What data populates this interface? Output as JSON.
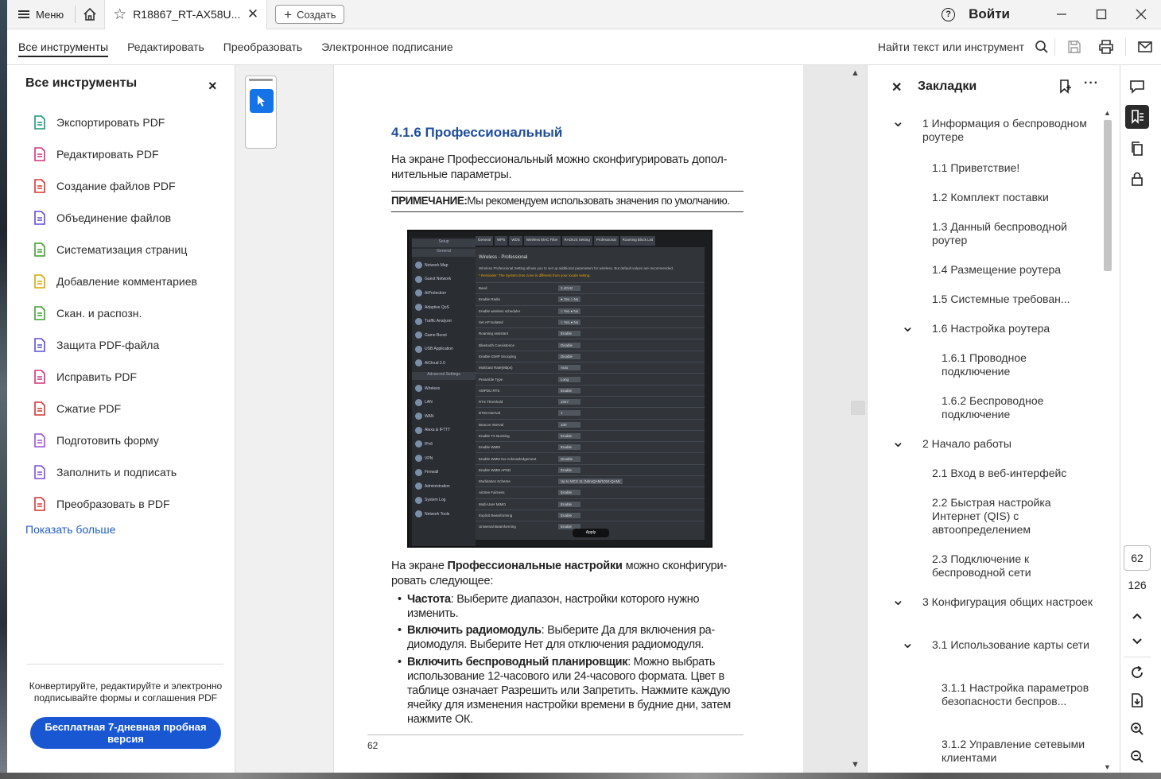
{
  "titlebar": {
    "menu_label": "Меню",
    "tab_name": "R18867_RT-AX58U...",
    "create_label": "Создать",
    "signin_label": "Войти"
  },
  "toolbar": {
    "tabs": [
      "Все инструменты",
      "Редактировать",
      "Преобразовать",
      "Электронное подписание"
    ],
    "find_label": "Найти текст или инструмент"
  },
  "tools": {
    "title": "Все инструменты",
    "items": [
      {
        "label": "Экспортировать PDF",
        "icon": "export-pdf-icon",
        "color": "#1a9a6c"
      },
      {
        "label": "Редактировать PDF",
        "icon": "edit-pdf-icon",
        "color": "#d2327b"
      },
      {
        "label": "Создание файлов PDF",
        "icon": "create-pdf-icon",
        "color": "#d83232"
      },
      {
        "label": "Объединение файлов",
        "icon": "combine-files-icon",
        "color": "#5b4fd6"
      },
      {
        "label": "Систематизация страниц",
        "icon": "organize-pages-icon",
        "color": "#3e9e2e"
      },
      {
        "label": "Добавление комментариев",
        "icon": "comment-icon",
        "color": "#d8a800"
      },
      {
        "label": "Скан. и распозн.",
        "icon": "scan-ocr-icon",
        "color": "#3e9e2e"
      },
      {
        "label": "Защита PDF-файла",
        "icon": "protect-pdf-icon",
        "color": "#5b4fd6"
      },
      {
        "label": "Исправить PDF",
        "icon": "redact-pdf-icon",
        "color": "#d2327b"
      },
      {
        "label": "Сжатие PDF",
        "icon": "compress-pdf-icon",
        "color": "#d83232"
      },
      {
        "label": "Подготовить форму",
        "icon": "prepare-form-icon",
        "color": "#9b4fd6"
      },
      {
        "label": "Заполнить и подписать",
        "icon": "fill-sign-icon",
        "color": "#7a4fd6"
      },
      {
        "label": "Преобразовать в PDF",
        "icon": "convert-pdf-icon",
        "color": "#d83232"
      }
    ],
    "show_more": "Показать больше",
    "promo_text": "Конвертируйте, редактируйте и электронно подписывайте формы и соглашения PDF",
    "trial_button": "Бесплатная 7-дневная пробная версия"
  },
  "document": {
    "section_heading": "4.1.6 Профессиональный",
    "intro": "На экране Профессиональный можно сконфигурировать допол-нительные параметры.",
    "note_label": "ПРИМЕЧАНИЕ:",
    "note_text": "Мы рекомендуем использовать значения по умолчанию.",
    "screenshot": {
      "sidebar": [
        "Setup",
        "General",
        "Network Map",
        "Guest Network",
        "AiProtection",
        "Adaptive QoS",
        "Traffic Analyzer",
        "Game Boost",
        "USB Application",
        "AiCloud 2.0",
        "Advanced Settings",
        "Wireless",
        "LAN",
        "WAN",
        "Alexa & IFTTT",
        "IPv6",
        "VPN",
        "Firewall",
        "Administration",
        "System Log",
        "Network Tools"
      ],
      "tabs": [
        "General",
        "WPS",
        "WDS",
        "Wireless MAC Filter",
        "RADIUS Setting",
        "Professional",
        "Roaming Block List"
      ],
      "title": "Wireless - Professional",
      "description": "Wireless Professional Setting allows you to set up additional parameters for wireless. But default values are recommended.",
      "warning": "* Reminder: The System time zone is different from your locale setting.",
      "rows": [
        [
          "Band",
          "2.4GHz"
        ],
        [
          "Enable Radio",
          "● Yes ○ No"
        ],
        [
          "Enable wireless scheduler",
          "○ Yes ● No"
        ],
        [
          "Set AP Isolated",
          "○ Yes ● No"
        ],
        [
          "Roaming assistant",
          "Enable"
        ],
        [
          "Bluetooth Coexistence",
          "Disable"
        ],
        [
          "Enable IGMP Snooping",
          "Disable"
        ],
        [
          "Multicast Rate(Mbps)",
          "Auto"
        ],
        [
          "Preamble Type",
          "Long"
        ],
        [
          "AMPDU RTS",
          "Enable"
        ],
        [
          "RTS Threshold",
          "2347"
        ],
        [
          "DTIM Interval",
          "1"
        ],
        [
          "Beacon Interval",
          "100"
        ],
        [
          "Enable TX Bursting",
          "Enable"
        ],
        [
          "Enable WMM",
          "Enable"
        ],
        [
          "Enable WMM No-Acknowledgement",
          "Disable"
        ],
        [
          "Enable WMM APSD",
          "Enable"
        ],
        [
          "Modulation Scheme",
          "Up to MCS 11 (NitroQAM/1024-QAM)"
        ],
        [
          "Airtime Fairness",
          "Enable"
        ],
        [
          "Multi-User MIMO",
          "Enable"
        ],
        [
          "Explicit Beamforming",
          "Enable"
        ],
        [
          "Universal Beamforming",
          "Enable"
        ]
      ],
      "apply": "Apply"
    },
    "para2_pre": "На экране ",
    "para2_bold": "Профессиональные настройки",
    "para2_post": " можно сконфигури-ровать следующее:",
    "bullets": [
      {
        "bold": "Частота",
        "text": ":  Выберите диапазон, настройки которого нужно изменить."
      },
      {
        "bold": "Включить радиомодуль",
        "text": ":  Выберите Да для включения ра-диомодуля. Выберите Нет для отключения радиомодуля."
      },
      {
        "bold": "Включить беспроводный планировщик",
        "text": ": Можно выбрать использование 12-часового или 24-часового формата. Цвет в таблице означает Разрешить или Запретить. Нажмите каждую ячейку для изменения настройки времени в будние дни, затем нажмите ОК."
      }
    ],
    "page_number": "62"
  },
  "bookmarks": {
    "title": "Закладки",
    "items": [
      {
        "label": "1 Информация о беспроводном роутере",
        "level": 0,
        "expanded": true
      },
      {
        "label": "1.1 Приветствие!",
        "level": 1
      },
      {
        "label": "1.2 Комплект поставки",
        "level": 1
      },
      {
        "label": "1.3 Данный беспроводной роутер",
        "level": 1
      },
      {
        "label": "1.4 Размещение роутера",
        "level": 1
      },
      {
        "label": "1.5 Системные требован...",
        "level": 1
      },
      {
        "label": "1.6 Настройка роутера",
        "level": 1,
        "expanded": true
      },
      {
        "label": "1.6.1 Проводное подключение",
        "level": 2
      },
      {
        "label": "1.6.2 Беспроводное подключение",
        "level": 2
      },
      {
        "label": "2 Начало работы",
        "level": 0,
        "expanded": true
      },
      {
        "label": "2.1 Вход в веб-интерфейс",
        "level": 1
      },
      {
        "label": "2.2 Быстрая настройка Интернет (QIS) с автоопределением",
        "level": 1
      },
      {
        "label": "2.3 Подключение к беспроводной сети",
        "level": 1
      },
      {
        "label": "3 Конфигурация общих настроек",
        "level": 0,
        "expanded": true
      },
      {
        "label": "3.1 Использование карты сети",
        "level": 1,
        "expanded": true
      },
      {
        "label": "3.1.1 Настройка параметров безопасности беспров...",
        "level": 2
      },
      {
        "label": "3.1.2 Управление сетевыми клиентами",
        "level": 2
      }
    ]
  },
  "rail": {
    "current_page": "62",
    "total_pages": "126"
  }
}
